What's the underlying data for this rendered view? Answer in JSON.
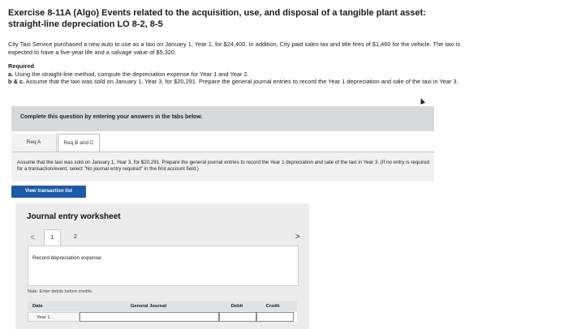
{
  "exercise": {
    "title": "Exercise 8-11A (Algo) Events related to the acquisition, use, and disposal of a tangible plant asset: straight-line depreciation LO 8-2, 8-5",
    "intro": "City Taxi Service purchased a new auto to use as a taxi on January 1, Year 1, for $24,400. In addition, City paid sales tax and title fees of $1,460 for the vehicle. The taxi is expected to have a five-year life and a salvage value of $5,320.",
    "required_label": "Required",
    "req_a_prefix": "a.",
    "req_a_text": "Using the straight-line method, compute the depreciation expense for Year 1 and Year 2.",
    "req_bc_prefix": "b & c.",
    "req_bc_text": "Assume that the taxi was sold on January 1, Year 3, for $20,291. Prepare the general journal entries to record the Year 1 depreciation and sale of the taxi in Year 3."
  },
  "banner": {
    "text": "Complete this question by entering your answers in the tabs below."
  },
  "tabs": [
    {
      "label": "Req A"
    },
    {
      "label": "Req B and C"
    }
  ],
  "tab_panel": {
    "instructions": "Assume that the taxi was sold on January 1, Year 3, for $20,291. Prepare the general journal entries to record the Year 1 depreciation and sale of the taxi in Year 3. (If no entry is required for a transaction/event, select \"No journal entry required\" in the first account field.)"
  },
  "view_button": {
    "label": "View transaction list"
  },
  "worksheet": {
    "title": "Journal entry worksheet",
    "prev": "<",
    "next": ">",
    "pages": [
      "1",
      "2"
    ],
    "entry_description": "Record depreciation expense.",
    "note": "Note: Enter debits before credits.",
    "columns": [
      "Date",
      "General Journal",
      "Debit",
      "Credit"
    ],
    "rows": [
      {
        "date": "Year 1",
        "account": "",
        "debit": "",
        "credit": ""
      }
    ]
  }
}
